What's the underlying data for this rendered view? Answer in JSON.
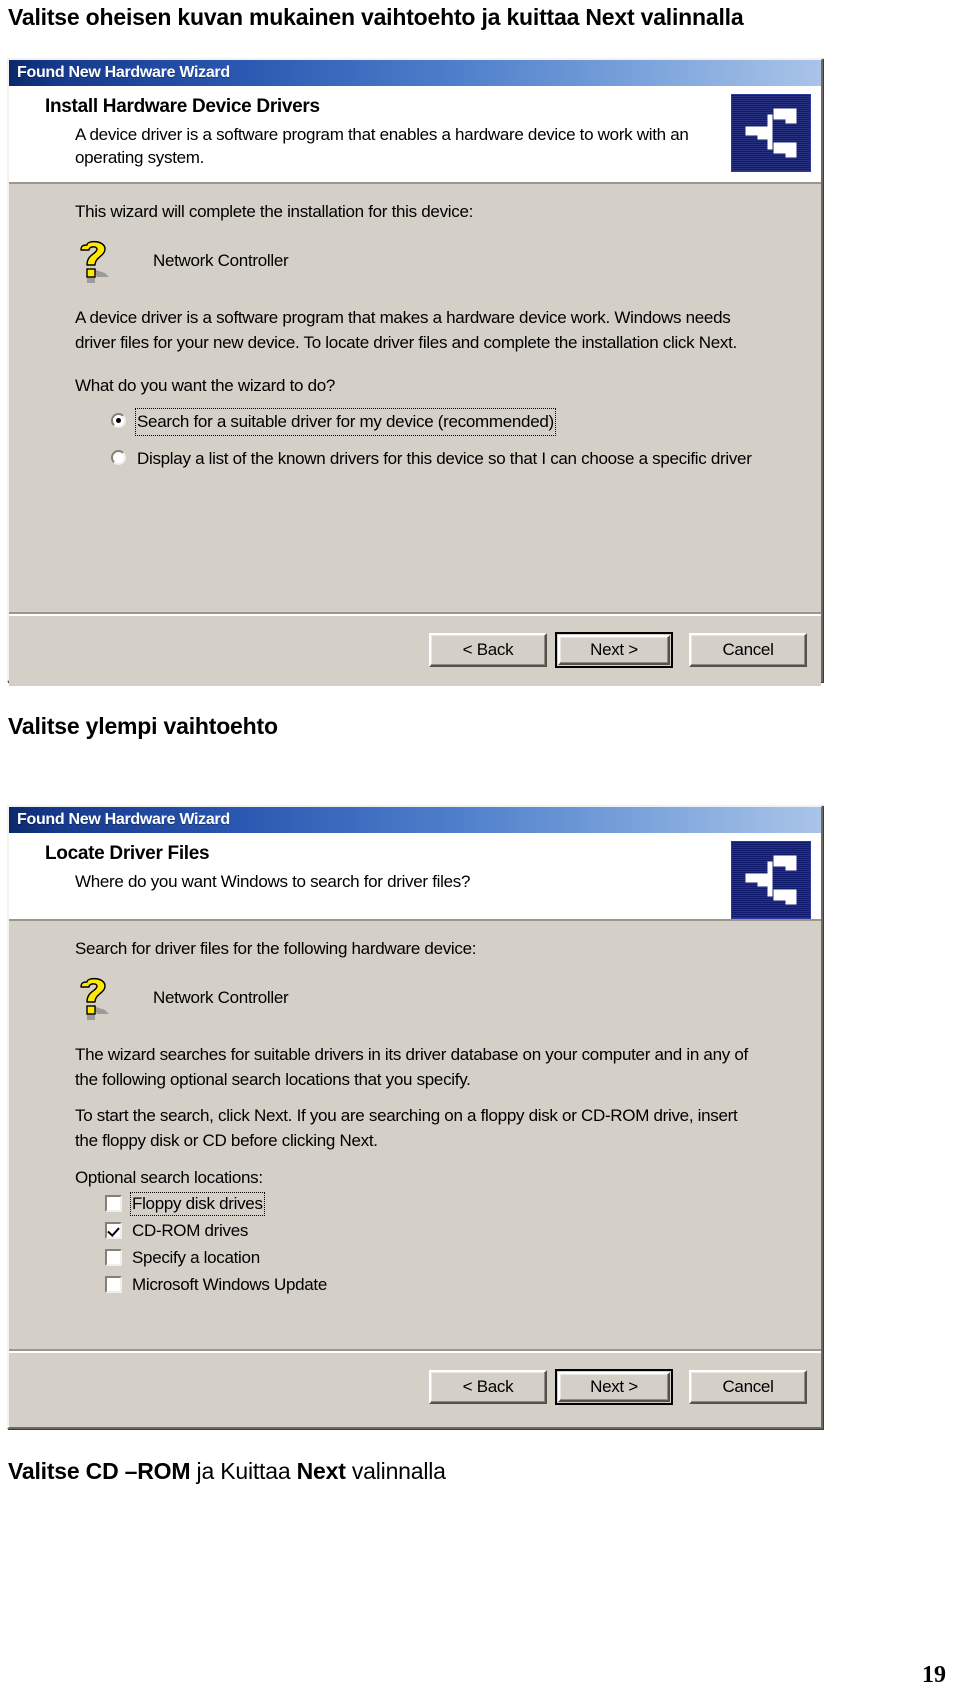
{
  "document": {
    "captions": {
      "top": "Valitse oheisen kuvan mukainen vaihtoehto ja kuittaa Next  valinnalla",
      "middle": "Valitse ylempi vaihtoehto",
      "bottom_bold_1": "Valitse CD –ROM",
      "bottom_regular_1": " ja Kuittaa ",
      "bottom_bold_2": "Next",
      "bottom_regular_2": "  valinnalla"
    },
    "page_number": "19"
  },
  "wizard1": {
    "title": "Found New Hardware Wizard",
    "header": {
      "heading": "Install Hardware Device Drivers",
      "subtext": "A device driver is a software program that enables a hardware device to work with an operating system.",
      "icon": "network-computer-icon"
    },
    "body": {
      "intro": "This wizard will complete the installation for this device:",
      "device_icon": "yellow-question-mark-icon",
      "device_name": "Network Controller",
      "description": "A device driver is a software program that makes a hardware device work. Windows needs driver files for your new device. To locate driver files and complete the installation click Next.",
      "prompt": "What do you want the wizard to do?",
      "options": [
        {
          "label": "Search for a suitable driver for my device (recommended)",
          "selected": true,
          "focused": true
        },
        {
          "label": "Display a list of the known drivers for this device so that I can choose a specific driver",
          "selected": false,
          "focused": false
        }
      ]
    },
    "buttons": {
      "back": "< Back",
      "next": "Next >",
      "cancel": "Cancel",
      "default": "Next >"
    }
  },
  "wizard2": {
    "title": "Found New Hardware Wizard",
    "header": {
      "heading": "Locate Driver Files",
      "subtext": "Where do you want Windows to search for driver files?",
      "icon": "network-computer-icon"
    },
    "body": {
      "intro": "Search for driver files for the following hardware device:",
      "device_icon": "yellow-question-mark-icon",
      "device_name": "Network Controller",
      "paragraph1": "The wizard searches for suitable drivers in its driver database on your computer and in any of the following optional search locations that you specify.",
      "paragraph2": "To start the search, click Next. If you are searching on a floppy disk or CD-ROM drive, insert the floppy disk or CD before clicking Next.",
      "checkbox_title": "Optional search locations:",
      "checkboxes": [
        {
          "label": "Floppy disk drives",
          "checked": false,
          "focused": true
        },
        {
          "label": "CD-ROM drives",
          "checked": true,
          "focused": false
        },
        {
          "label": "Specify a location",
          "checked": false,
          "focused": false
        },
        {
          "label": "Microsoft Windows Update",
          "checked": false,
          "focused": false
        }
      ]
    },
    "buttons": {
      "back": "< Back",
      "next": "Next >",
      "cancel": "Cancel",
      "default": "Next >"
    }
  },
  "colors": {
    "titlebar_start": "#0b2a6b",
    "titlebar_end": "#aac4e8",
    "dialog_face": "#d4d0c8",
    "icon_yellow": "#ffe800",
    "icon_blue": "#101a6e"
  }
}
